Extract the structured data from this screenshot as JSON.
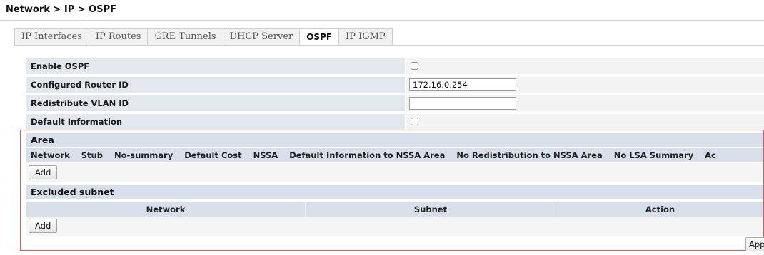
{
  "breadcrumb": "Network > IP > OSPF",
  "tabs": [
    {
      "label": "IP Interfaces",
      "active": false
    },
    {
      "label": "IP Routes",
      "active": false
    },
    {
      "label": "GRE Tunnels",
      "active": false
    },
    {
      "label": "DHCP Server",
      "active": false
    },
    {
      "label": "OSPF",
      "active": true
    },
    {
      "label": "IP IGMP",
      "active": false
    }
  ],
  "form": {
    "enable_ospf": {
      "label": "Enable OSPF",
      "checked": false
    },
    "router_id": {
      "label": "Configured Router ID",
      "value": "172.16.0.254"
    },
    "redistribute_vlan": {
      "label": "Redistribute VLAN ID",
      "value": ""
    },
    "default_information": {
      "label": "Default Information",
      "checked": false
    }
  },
  "area": {
    "title": "Area",
    "columns": [
      "Network",
      "Stub",
      "No-summary",
      "Default Cost",
      "NSSA",
      "Default Information to NSSA Area",
      "No Redistribution to NSSA Area",
      "No LSA Summary",
      "Ac"
    ],
    "add_label": "Add"
  },
  "excluded_subnet": {
    "title": "Excluded subnet",
    "columns": [
      "Network",
      "Subnet",
      "Action"
    ],
    "add_label": "Add"
  },
  "apply_label": "App",
  "colors": {
    "label_bg": "#e3e7ee",
    "section_header_bg": "#d7e0ea",
    "highlight_border": "#e2594a"
  }
}
